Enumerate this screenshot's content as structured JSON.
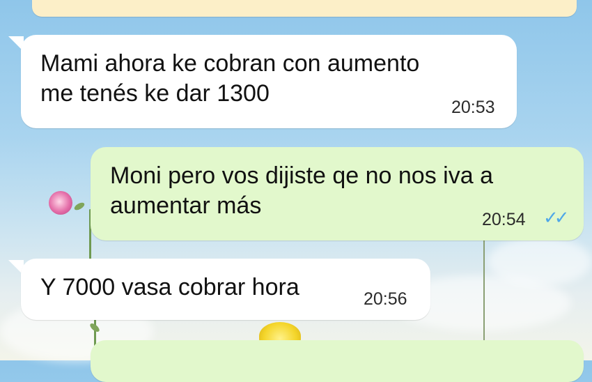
{
  "chat": {
    "messages": [
      {
        "direction": "incoming",
        "text": "Mami ahora ke cobran con aumento\nme tenés ke dar 1300",
        "time": "20:53"
      },
      {
        "direction": "outgoing",
        "text": "Moni pero vos dijiste qe no nos iva a\naumentar más",
        "time": "20:54",
        "status_icon": "double-check-icon",
        "status_color": "#4fa7e8"
      },
      {
        "direction": "incoming",
        "text": "Y 7000 vasa cobrar hora",
        "time": "20:56"
      }
    ]
  },
  "colors": {
    "incoming_bubble": "#ffffff",
    "outgoing_bubble": "#e2f8cc",
    "system_banner": "#fcefc8",
    "read_ticks": "#4fa7e8"
  }
}
